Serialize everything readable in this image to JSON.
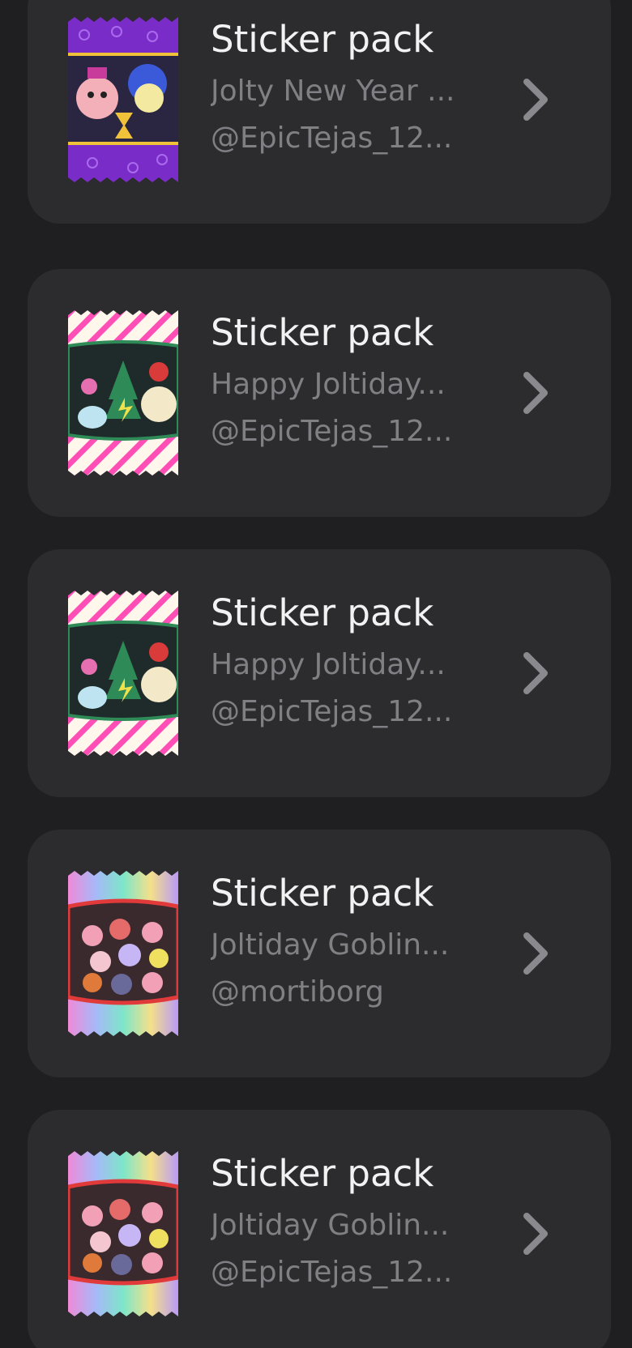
{
  "packs": [
    {
      "title": "Sticker pack",
      "description": "Jolty New Year ...",
      "author": "@EpicTejas_12...",
      "theme": "purple-new-year",
      "colors": {
        "wrapper": "#7a2cc9",
        "edge": "#9b4ee8",
        "band": "#2a2540",
        "accent": "#f0c23a"
      }
    },
    {
      "title": "Sticker pack",
      "description": "Happy Joltiday...",
      "author": "@EpicTejas_12...",
      "theme": "pink-stripes-holiday",
      "colors": {
        "wrapper": "#fff6ec",
        "edge": "#ff4fb6",
        "band": "#1e2b2a",
        "accent": "#2e8b57"
      }
    },
    {
      "title": "Sticker pack",
      "description": "Happy Joltiday...",
      "author": "@EpicTejas_12...",
      "theme": "pink-stripes-holiday",
      "colors": {
        "wrapper": "#fff6ec",
        "edge": "#ff4fb6",
        "band": "#1e2b2a",
        "accent": "#2e8b57"
      }
    },
    {
      "title": "Sticker pack",
      "description": "Joltiday Goblin...",
      "author": "@mortiborg",
      "theme": "rainbow-goblin",
      "colors": {
        "wrapper": "#b9a7f5",
        "edge": "#7de6c9",
        "band": "#3a2a2e",
        "accent": "#e03a3a"
      }
    },
    {
      "title": "Sticker pack",
      "description": "Joltiday Goblin...",
      "author": "@EpicTejas_12...",
      "theme": "rainbow-goblin",
      "colors": {
        "wrapper": "#b9a7f5",
        "edge": "#7de6c9",
        "band": "#3a2a2e",
        "accent": "#e03a3a"
      }
    }
  ],
  "icons": {
    "chevron": "chevron-right-icon",
    "thumbnail": "sticker-pack-thumbnail"
  },
  "colors": {
    "background": "#1f1e20",
    "card": "#2c2b2e",
    "title": "#f2f2f2",
    "subtitle": "#807f84",
    "chevron": "#8a898e"
  }
}
